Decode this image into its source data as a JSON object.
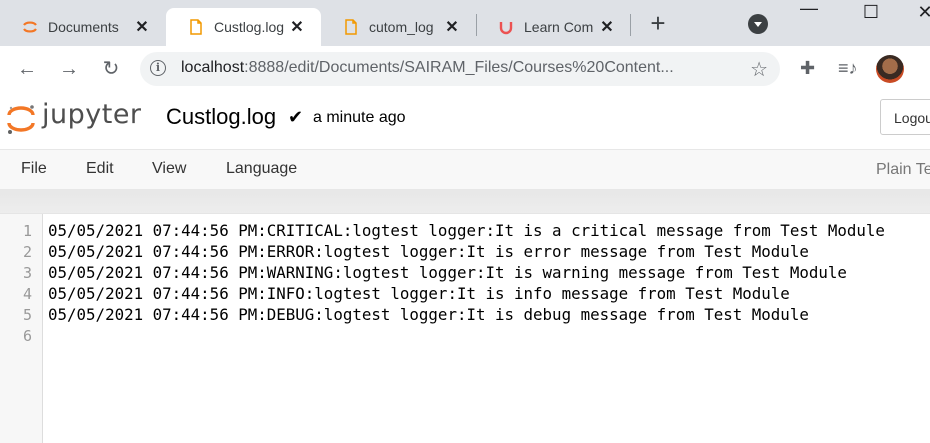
{
  "browser": {
    "tabs": [
      {
        "title": "Documents",
        "icon": "jupyter-icon"
      },
      {
        "title": "Custlog.log",
        "icon": "file-icon",
        "active": true
      },
      {
        "title": "cutom_log",
        "icon": "file-icon"
      },
      {
        "title": "Learn Com",
        "icon": "udemy-icon"
      }
    ],
    "new_tab": "+",
    "url_host": "localhost",
    "url_rest": ":8888/edit/Documents/SAIRAM_Files/Courses%20Content..."
  },
  "jupyter": {
    "logo_text": "jupyter",
    "file_name": "Custlog.log",
    "save_status": "a minute ago",
    "logout_label": "Logout",
    "menu": [
      "File",
      "Edit",
      "View",
      "Language"
    ],
    "mode": "Plain Text"
  },
  "editor": {
    "line_numbers": [
      "1",
      "2",
      "3",
      "4",
      "5",
      "6"
    ],
    "lines": [
      "05/05/2021 07:44:56 PM:CRITICAL:logtest logger:It is a critical message from Test Module",
      "05/05/2021 07:44:56 PM:ERROR:logtest logger:It is error message from Test Module",
      "05/05/2021 07:44:56 PM:WARNING:logtest logger:It is warning message from Test Module",
      "05/05/2021 07:44:56 PM:INFO:logtest logger:It is info message from Test Module",
      "05/05/2021 07:44:56 PM:DEBUG:logtest logger:It is debug message from Test Module",
      ""
    ]
  },
  "colors": {
    "tabstrip": "#dee1e6",
    "jupyter_orange": "#f37726",
    "udemy_red": "#a435f0"
  }
}
